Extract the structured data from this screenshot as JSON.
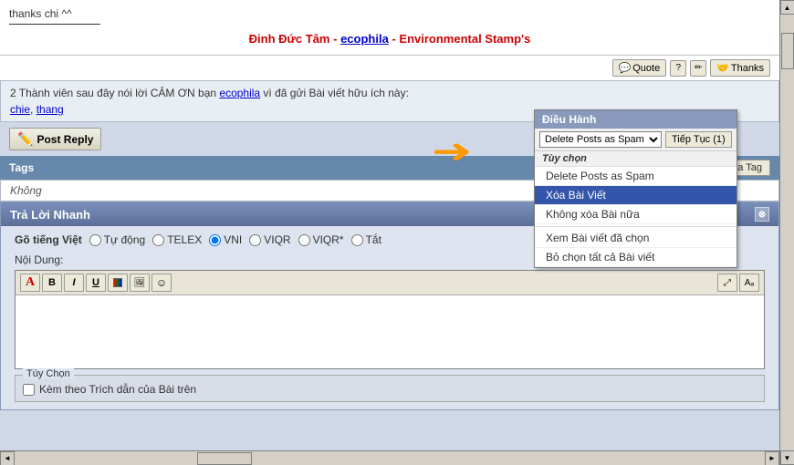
{
  "top": {
    "thanks_text": "thanks chi ^^",
    "underline": true,
    "author_line": {
      "prefix": "",
      "name": "Đinh Đức Tâm",
      "sep1": " - ",
      "eco": "ecophila",
      "sep2": " - Environmental Stamp's"
    }
  },
  "action_buttons": {
    "quote": "Quote",
    "thanks": "Thanks"
  },
  "thank_members": {
    "main_text_pre": "2 Thành viên sau đây nói lời CẢM ƠN bạn ",
    "eco_link": "ecophila",
    "main_text_post": " vì đã gửi Bài viết hữu ích này:",
    "members": [
      {
        "name": "chie",
        "sep": ", "
      },
      {
        "name": "thang",
        "sep": ""
      }
    ]
  },
  "post_reply": {
    "label": "Post Reply"
  },
  "tags_section": {
    "label": "Tags",
    "value": "Không",
    "edit_btn": "Chỉnh sửa Tag"
  },
  "dropdown": {
    "header": "Điều Hành",
    "select_value": "Delete Posts as Spam",
    "tiep_tuc_label": "Tiếp Tục (1)",
    "tuy_chon_header": "Tùy chọn",
    "items": [
      {
        "label": "Delete Posts as Spam",
        "selected": false
      },
      {
        "label": "Xóa Bài Viết",
        "selected": true
      },
      {
        "label": "Không xóa Bài nữa",
        "selected": false
      },
      {
        "label": "",
        "divider": true
      },
      {
        "label": "Xem Bài viết đã chọn",
        "selected": false
      },
      {
        "label": "Bỏ chọn tất cả Bài viết",
        "selected": false
      }
    ]
  },
  "tra_loi": {
    "header": "Trả Lời Nhanh",
    "go_viet": {
      "label": "Gõ tiếng Việt",
      "options": [
        {
          "label": "Tự động",
          "value": "auto",
          "checked": false
        },
        {
          "label": "TELEX",
          "value": "telex",
          "checked": false
        },
        {
          "label": "VNI",
          "value": "vni",
          "checked": true
        },
        {
          "label": "VIQR",
          "value": "viqr",
          "checked": false
        },
        {
          "label": "VIQR*",
          "value": "viqr2",
          "checked": false
        },
        {
          "label": "Tắt",
          "value": "off",
          "checked": false
        }
      ]
    },
    "noi_dung_label": "Nội Dung:",
    "editor_toolbar": {
      "buttons": [
        "A",
        "B",
        "I",
        "U",
        "🎨",
        "🖼",
        "😊"
      ]
    },
    "tuy_chon": {
      "legend": "Tùy Chọn",
      "checkbox_label": "Kèm theo Trích dẫn của Bài trên"
    }
  }
}
